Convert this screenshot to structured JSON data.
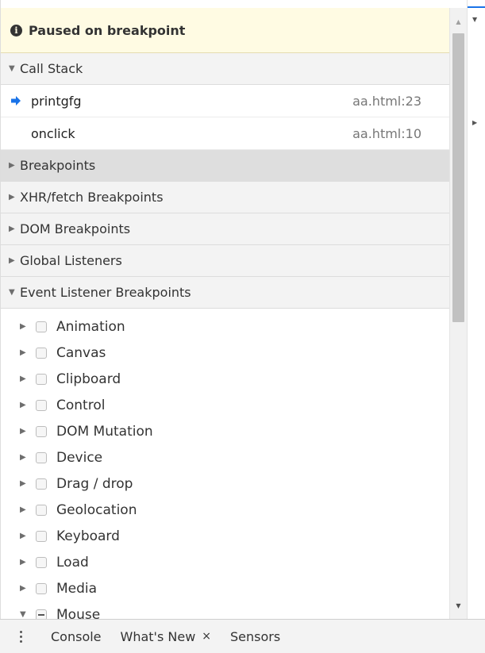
{
  "paused": {
    "text": "Paused on breakpoint",
    "icon": "info-icon"
  },
  "call_stack": {
    "title": "Call Stack",
    "expanded": true,
    "frames": [
      {
        "name": "printgfg",
        "location": "aa.html:23",
        "current": true
      },
      {
        "name": "onclick",
        "location": "aa.html:10",
        "current": false
      }
    ]
  },
  "sections": {
    "breakpoints": "Breakpoints",
    "xhr": "XHR/fetch Breakpoints",
    "dom": "DOM Breakpoints",
    "global": "Global Listeners",
    "event": "Event Listener Breakpoints"
  },
  "event_listeners": [
    {
      "label": "Animation",
      "expanded": false,
      "checked": false
    },
    {
      "label": "Canvas",
      "expanded": false,
      "checked": false
    },
    {
      "label": "Clipboard",
      "expanded": false,
      "checked": false
    },
    {
      "label": "Control",
      "expanded": false,
      "checked": false
    },
    {
      "label": "DOM Mutation",
      "expanded": false,
      "checked": false
    },
    {
      "label": "Device",
      "expanded": false,
      "checked": false
    },
    {
      "label": "Drag / drop",
      "expanded": false,
      "checked": false
    },
    {
      "label": "Geolocation",
      "expanded": false,
      "checked": false
    },
    {
      "label": "Keyboard",
      "expanded": false,
      "checked": false
    },
    {
      "label": "Load",
      "expanded": false,
      "checked": false
    },
    {
      "label": "Media",
      "expanded": false,
      "checked": false
    },
    {
      "label": "Mouse",
      "expanded": true,
      "checked": "mixed"
    }
  ],
  "drawer": {
    "tabs": [
      {
        "label": "Console",
        "closable": false
      },
      {
        "label": "What's New",
        "closable": true
      },
      {
        "label": "Sensors",
        "closable": false
      }
    ],
    "close_glyph": "×"
  },
  "colors": {
    "paused_bg": "#fffbe3",
    "current_frame_arrow": "#1a73e8",
    "section_bg": "#f3f3f3"
  }
}
